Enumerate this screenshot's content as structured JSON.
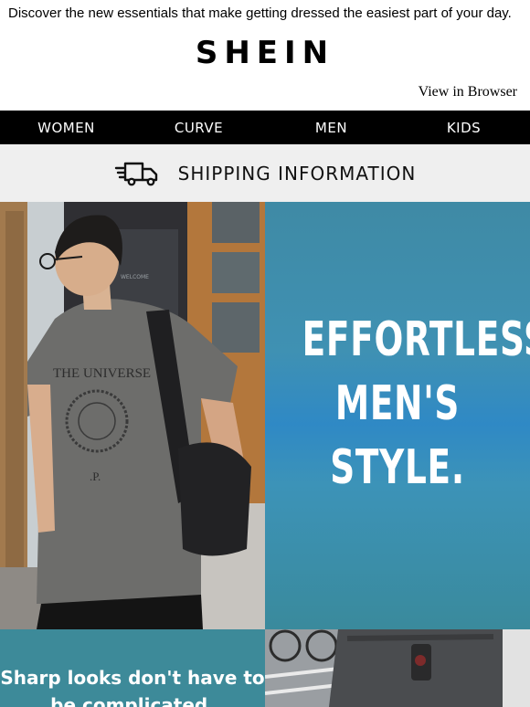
{
  "preheader": "Discover the new essentials that make getting dressed the easiest part of your day.",
  "brand": "SHEIN",
  "view_in_browser": "View in Browser",
  "nav": [
    "WOMEN",
    "CURVE",
    "MEN",
    "KIDS"
  ],
  "shipping": {
    "label": "SHIPPING INFORMATION",
    "icon": "delivery-truck-icon"
  },
  "hero": {
    "headline_lines": [
      "EFFORTLESS",
      "MEN'S",
      "STYLE."
    ],
    "shirt_text": "THE UNIVERSE",
    "shirt_letter": ".P.",
    "door_sign": "WELCOME"
  },
  "promo": {
    "text": "Sharp looks don't have to be complicated."
  },
  "colors": {
    "nav_bg": "#000000",
    "shipping_bg": "#efefef",
    "panel_teal": "#3f8fb0",
    "promo_teal": "#3d8a99"
  }
}
